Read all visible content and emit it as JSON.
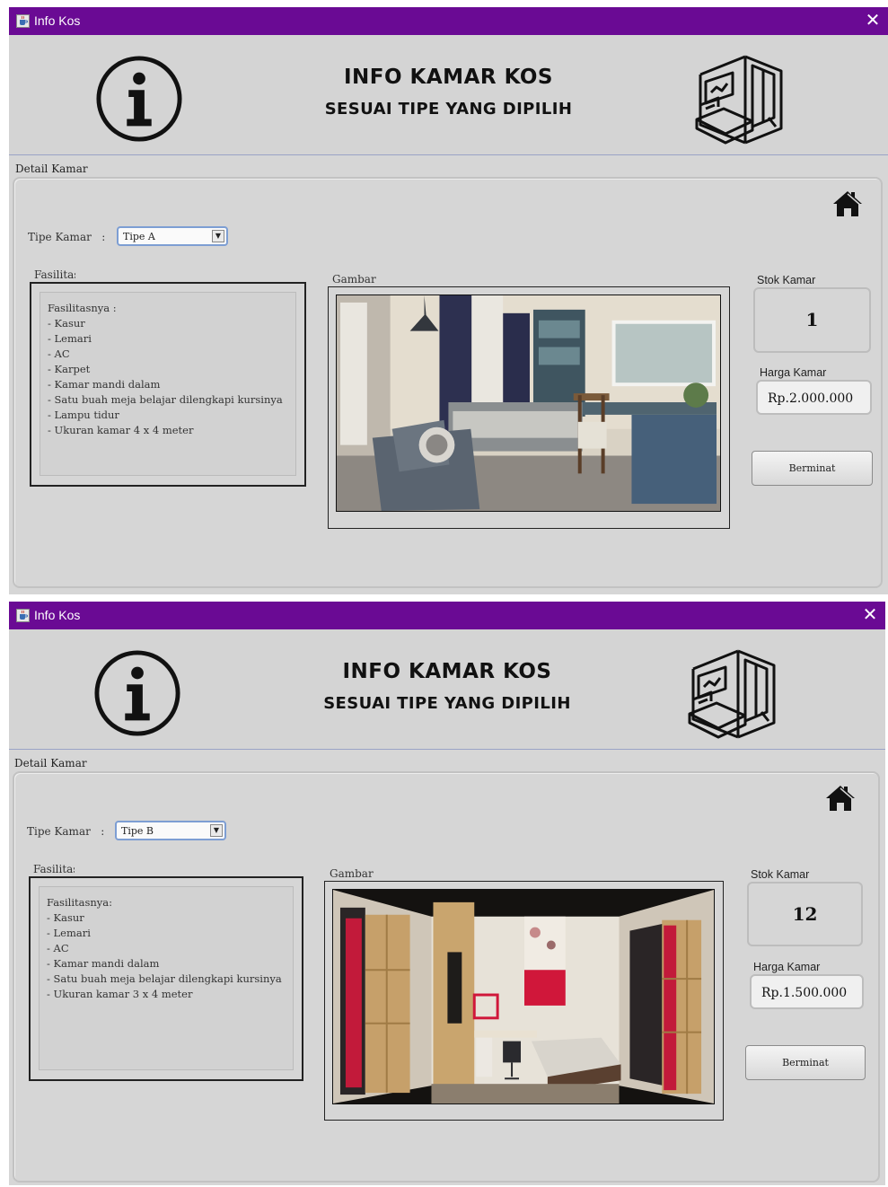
{
  "windows": [
    {
      "title": "Info Kos",
      "header": {
        "title": "INFO KAMAR KOS",
        "subtitle": "SESUAI TIPE YANG DIPILIH"
      },
      "detail": {
        "section_label": "Detail Kamar",
        "tipe_label": "Tipe Kamar   :",
        "tipe_value": "Tipe A",
        "fasilitas_label": "Fasilitas",
        "fasilitas_lines": [
          "Fasilitasnya :",
          "- Kasur",
          "- Lemari",
          "- AC",
          "- Karpet",
          "- Kamar mandi dalam",
          "- Satu buah meja belajar dilengkapi kursinya",
          "- Lampu tidur",
          "- Ukuran kamar 4 x 4 meter"
        ],
        "gambar_label": "Gambar",
        "stok_label": "Stok Kamar",
        "stok_value": "1",
        "harga_label": "Harga Kamar",
        "harga_value": "Rp.2.000.000",
        "button_label": "Berminat"
      }
    },
    {
      "title": "Info Kos",
      "header": {
        "title": "INFO KAMAR KOS",
        "subtitle": "SESUAI TIPE YANG DIPILIH"
      },
      "detail": {
        "section_label": "Detail Kamar",
        "tipe_label": "Tipe Kamar   :",
        "tipe_value": "Tipe B",
        "fasilitas_label": "Fasilitas",
        "fasilitas_lines": [
          "Fasilitasnya:",
          "- Kasur",
          "- Lemari",
          "- AC",
          "- Kamar mandi dalam",
          "- Satu buah meja belajar dilengkapi kursinya",
          "- Ukuran kamar 3 x 4 meter"
        ],
        "gambar_label": "Gambar",
        "stok_label": "Stok Kamar",
        "stok_value": "12",
        "harga_label": "Harga Kamar",
        "harga_value": "Rp.1.500.000",
        "button_label": "Berminat"
      }
    }
  ],
  "icons": {
    "app": "java-cup-icon",
    "close": "close-icon",
    "info": "info-circle-icon",
    "bedroom": "bedroom-icon",
    "home": "home-icon",
    "dropdown": "chevron-down-icon"
  },
  "colors": {
    "titlebar": "#6a0a94",
    "window_bg": "#d6d6d6",
    "select_border": "#7d9ed3"
  }
}
